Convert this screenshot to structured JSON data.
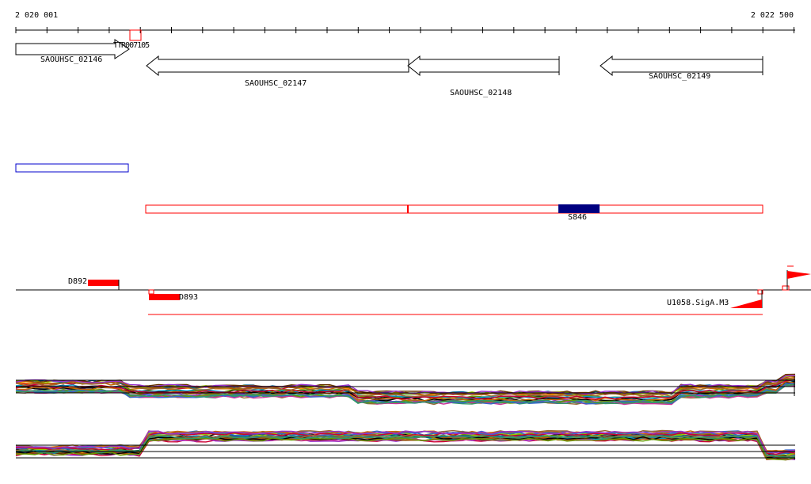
{
  "coordinates": {
    "start": "2 020 001",
    "end": "2 022 500"
  },
  "genes": [
    {
      "name": "SAOUHSC_02146"
    },
    {
      "name": "SAOUHSC_02147"
    },
    {
      "name": "SAOUHSC_02148"
    },
    {
      "name": "SAOUHSC_02149"
    }
  ],
  "small_label": "TTR007105",
  "features": {
    "s_label": "S846",
    "d1_label": "D892",
    "d2_label": "D893",
    "u_label": "U1058.SigA.M3"
  },
  "colors": {
    "outline_black": "#000000",
    "blue_outline": "#0000cc",
    "red": "#ff0000",
    "navy_fill": "#000080"
  }
}
